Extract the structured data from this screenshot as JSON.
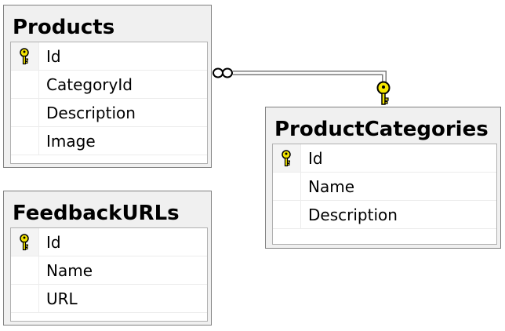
{
  "tables": [
    {
      "name": "Products",
      "columns": [
        {
          "name": "Id",
          "primary_key": true
        },
        {
          "name": "CategoryId",
          "primary_key": false
        },
        {
          "name": "Description",
          "primary_key": false
        },
        {
          "name": "Image",
          "primary_key": false
        }
      ]
    },
    {
      "name": "FeedbackURLs",
      "columns": [
        {
          "name": "Id",
          "primary_key": true
        },
        {
          "name": "Name",
          "primary_key": false
        },
        {
          "name": "URL",
          "primary_key": false
        }
      ]
    },
    {
      "name": "ProductCategories",
      "columns": [
        {
          "name": "Id",
          "primary_key": true
        },
        {
          "name": "Name",
          "primary_key": false
        },
        {
          "name": "Description",
          "primary_key": false
        }
      ]
    }
  ],
  "relationships": [
    {
      "from_table": "Products",
      "from_end": "many",
      "to_table": "ProductCategories",
      "to_end": "one"
    }
  ],
  "colors": {
    "header_background": "#f0f0f0",
    "key_icon": "#f5e600",
    "key_outline": "#000000"
  }
}
